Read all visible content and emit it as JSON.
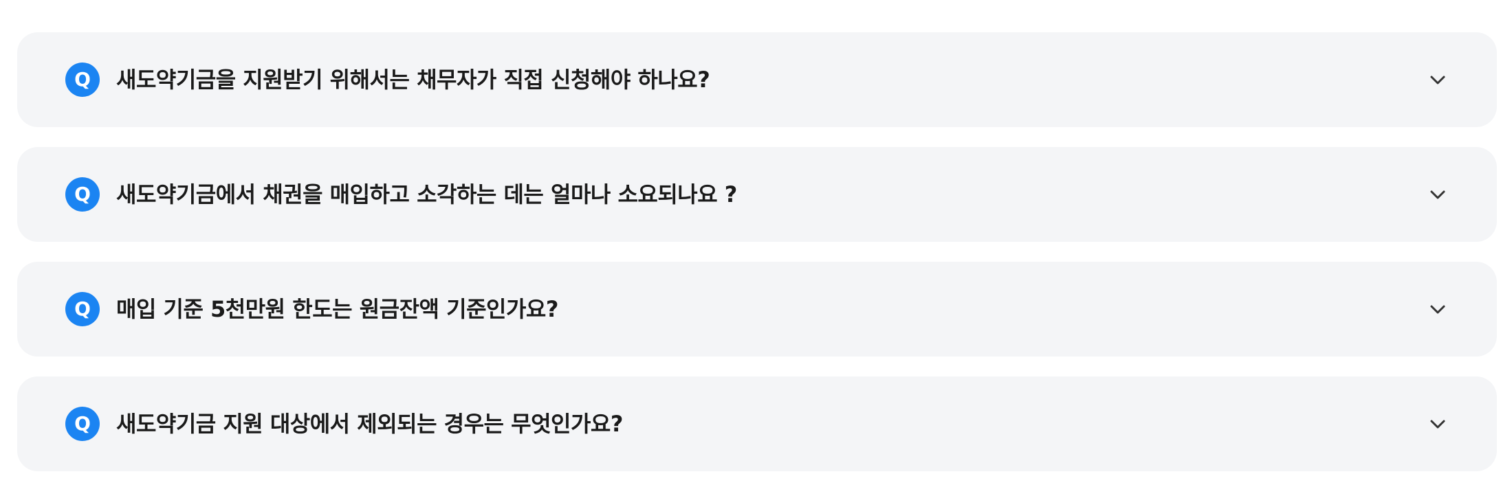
{
  "faq": {
    "badge_label": "Q",
    "items": [
      {
        "question": "새도약기금을 지원받기 위해서는 채무자가 직접 신청해야 하나요?",
        "icon": "chevron-down-icon"
      },
      {
        "question": "새도약기금에서 채권을 매입하고 소각하는 데는 얼마나 소요되나요 ?",
        "icon": "chevron-down-icon"
      },
      {
        "question": "매입 기준 5천만원 한도는 원금잔액 기준인가요?",
        "icon": "chevron-down-icon"
      },
      {
        "question": "새도약기금 지원 대상에서 제외되는 경우는 무엇인가요?",
        "icon": "chevron-down-icon"
      }
    ],
    "colors": {
      "item_background": "#f4f5f7",
      "badge": "#1b84f2",
      "text": "#1a1a1a",
      "chevron": "#333333"
    }
  }
}
